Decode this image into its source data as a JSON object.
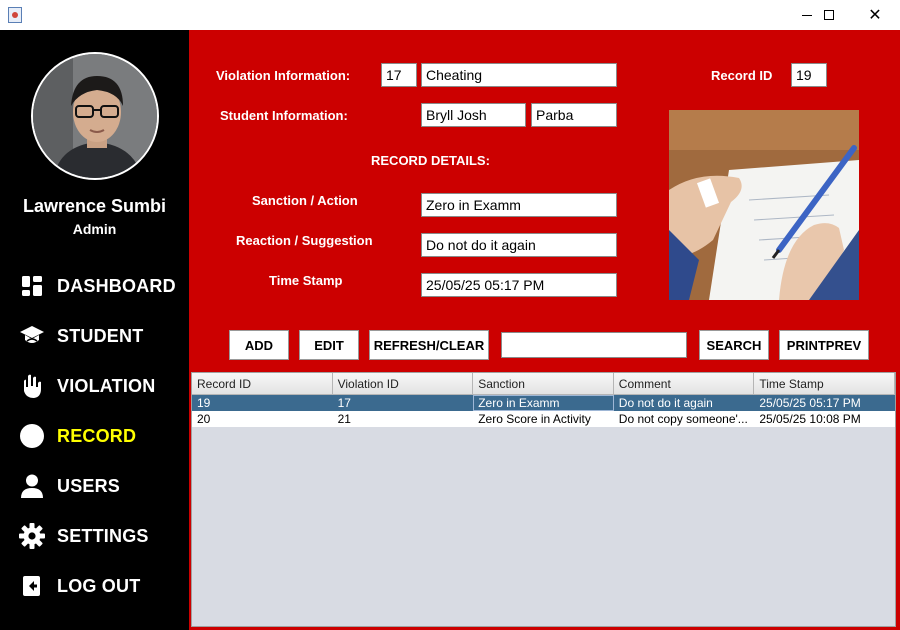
{
  "window": {
    "min_icon": "minimize-icon",
    "max_icon": "maximize-icon",
    "close_icon": "close-icon",
    "close_glyph": "✕"
  },
  "user": {
    "name": "Lawrence Sumbi",
    "role": "Admin"
  },
  "nav": [
    {
      "label": "DASHBOARD",
      "icon": "dashboard-icon"
    },
    {
      "label": "STUDENT",
      "icon": "graduation-cap-icon"
    },
    {
      "label": "VIOLATION",
      "icon": "hand-stop-icon"
    },
    {
      "label": "RECORD",
      "icon": "circle-icon",
      "active": true
    },
    {
      "label": "USERS",
      "icon": "user-icon"
    },
    {
      "label": "SETTINGS",
      "icon": "gear-icon"
    },
    {
      "label": "LOG OUT",
      "icon": "logout-icon"
    }
  ],
  "form": {
    "violation_label": "Violation Information:",
    "violation_id": "17",
    "violation_name": "Cheating",
    "record_id_label": "Record ID",
    "record_id": "19",
    "student_label": "Student Information:",
    "student_first": "Bryll Josh",
    "student_last": "Parba",
    "details_heading": "RECORD DETAILS:",
    "sanction_label": "Sanction / Action",
    "sanction_value": "Zero in Examm",
    "reaction_label": "Reaction / Suggestion",
    "reaction_value": "Do not do it again",
    "timestamp_label": "Time Stamp",
    "timestamp_value": "25/05/25 05:17 PM"
  },
  "actions": {
    "add": "ADD",
    "edit": "EDIT",
    "refresh": "REFRESH/CLEAR",
    "search": "SEARCH",
    "printprev": "PRINTPREV",
    "search_value": ""
  },
  "colors": {
    "panel": "#cc0000",
    "sidebar": "#000000",
    "active_nav": "#ffff00",
    "selected_row": "#3b6a8f"
  },
  "table": {
    "columns": [
      "Record ID",
      "Violation ID",
      "Sanction",
      "Comment",
      "Time Stamp"
    ],
    "rows": [
      [
        "19",
        "17",
        "Zero in Examm",
        "Do not do it again",
        "25/05/25 05:17 PM"
      ],
      [
        "20",
        "21",
        "Zero Score in Activity",
        "Do not copy someone'...",
        "25/05/25 10:08 PM"
      ]
    ]
  }
}
